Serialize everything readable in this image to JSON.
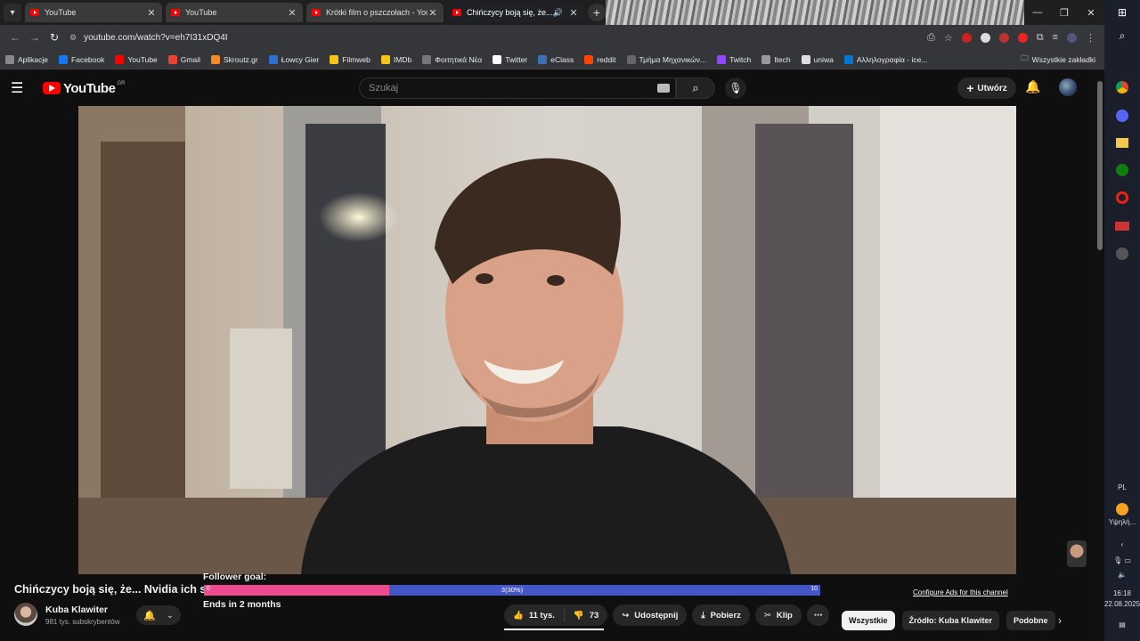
{
  "browser": {
    "tabs": [
      {
        "title": "YouTube",
        "active": false
      },
      {
        "title": "YouTube",
        "active": false
      },
      {
        "title": "Krótki film o pszczołach - YouTube",
        "active": false
      },
      {
        "title": "Chińczycy boją się, że... Nvidia",
        "active": true
      }
    ],
    "url": "youtube.com/watch?v=eh7I31xDQ4I",
    "bookmarks": [
      {
        "label": "Aplikacje",
        "color": "#888"
      },
      {
        "label": "Facebook",
        "color": "#1877f2"
      },
      {
        "label": "YouTube",
        "color": "#ff0000"
      },
      {
        "label": "Gmail",
        "color": "#ea4335"
      },
      {
        "label": "Skroutz.gr",
        "color": "#f68b24"
      },
      {
        "label": "Łowcy Gier",
        "color": "#2f6fd0"
      },
      {
        "label": "Filmweb",
        "color": "#f5c518"
      },
      {
        "label": "IMDb",
        "color": "#f5c518"
      },
      {
        "label": "Φοιτητικά Νέα",
        "color": "#777"
      },
      {
        "label": "Twitter",
        "color": "#ffffff"
      },
      {
        "label": "eClass",
        "color": "#3b6fb6"
      },
      {
        "label": "reddit",
        "color": "#ff4500"
      },
      {
        "label": "Τμήμα Μηχανικών...",
        "color": "#666"
      },
      {
        "label": "Twitch",
        "color": "#9146ff"
      },
      {
        "label": "Itech",
        "color": "#999"
      },
      {
        "label": "uniwa",
        "color": "#ddd"
      },
      {
        "label": "Αλληλογραφία - ice...",
        "color": "#0078d4"
      }
    ],
    "bookmarks_all": "Wszystkie zakładki"
  },
  "youtube": {
    "logo": "YouTube",
    "region": "GR",
    "search_placeholder": "Szukaj",
    "create_label": "Utwórz"
  },
  "video": {
    "title": "Chińczycy boją się, że... Nvidia ich s",
    "channel": "Kuba Klawiter",
    "subscribers": "981 tys. subskrybentów",
    "likes": "11 tys.",
    "dislikes": "73",
    "share": "Udostępnij",
    "download": "Pobierz",
    "clip": "Klip",
    "more": "⋯"
  },
  "overlay": {
    "goal_label": "Follower goal:",
    "goal_min": "0",
    "goal_current": "3(30%)",
    "goal_max": "10",
    "goal_progress": 0.3,
    "ends": "Ends in 2 months"
  },
  "sidebar": {
    "configure": "Configure Ads for this channel",
    "chips": [
      "Wszystkie",
      "Źródło: Kuba Klawiter",
      "Podobne"
    ]
  },
  "taskbar": {
    "lang": "PL",
    "weather": "Υψηλή...",
    "time": "16:18",
    "date": "22.08.2025"
  }
}
